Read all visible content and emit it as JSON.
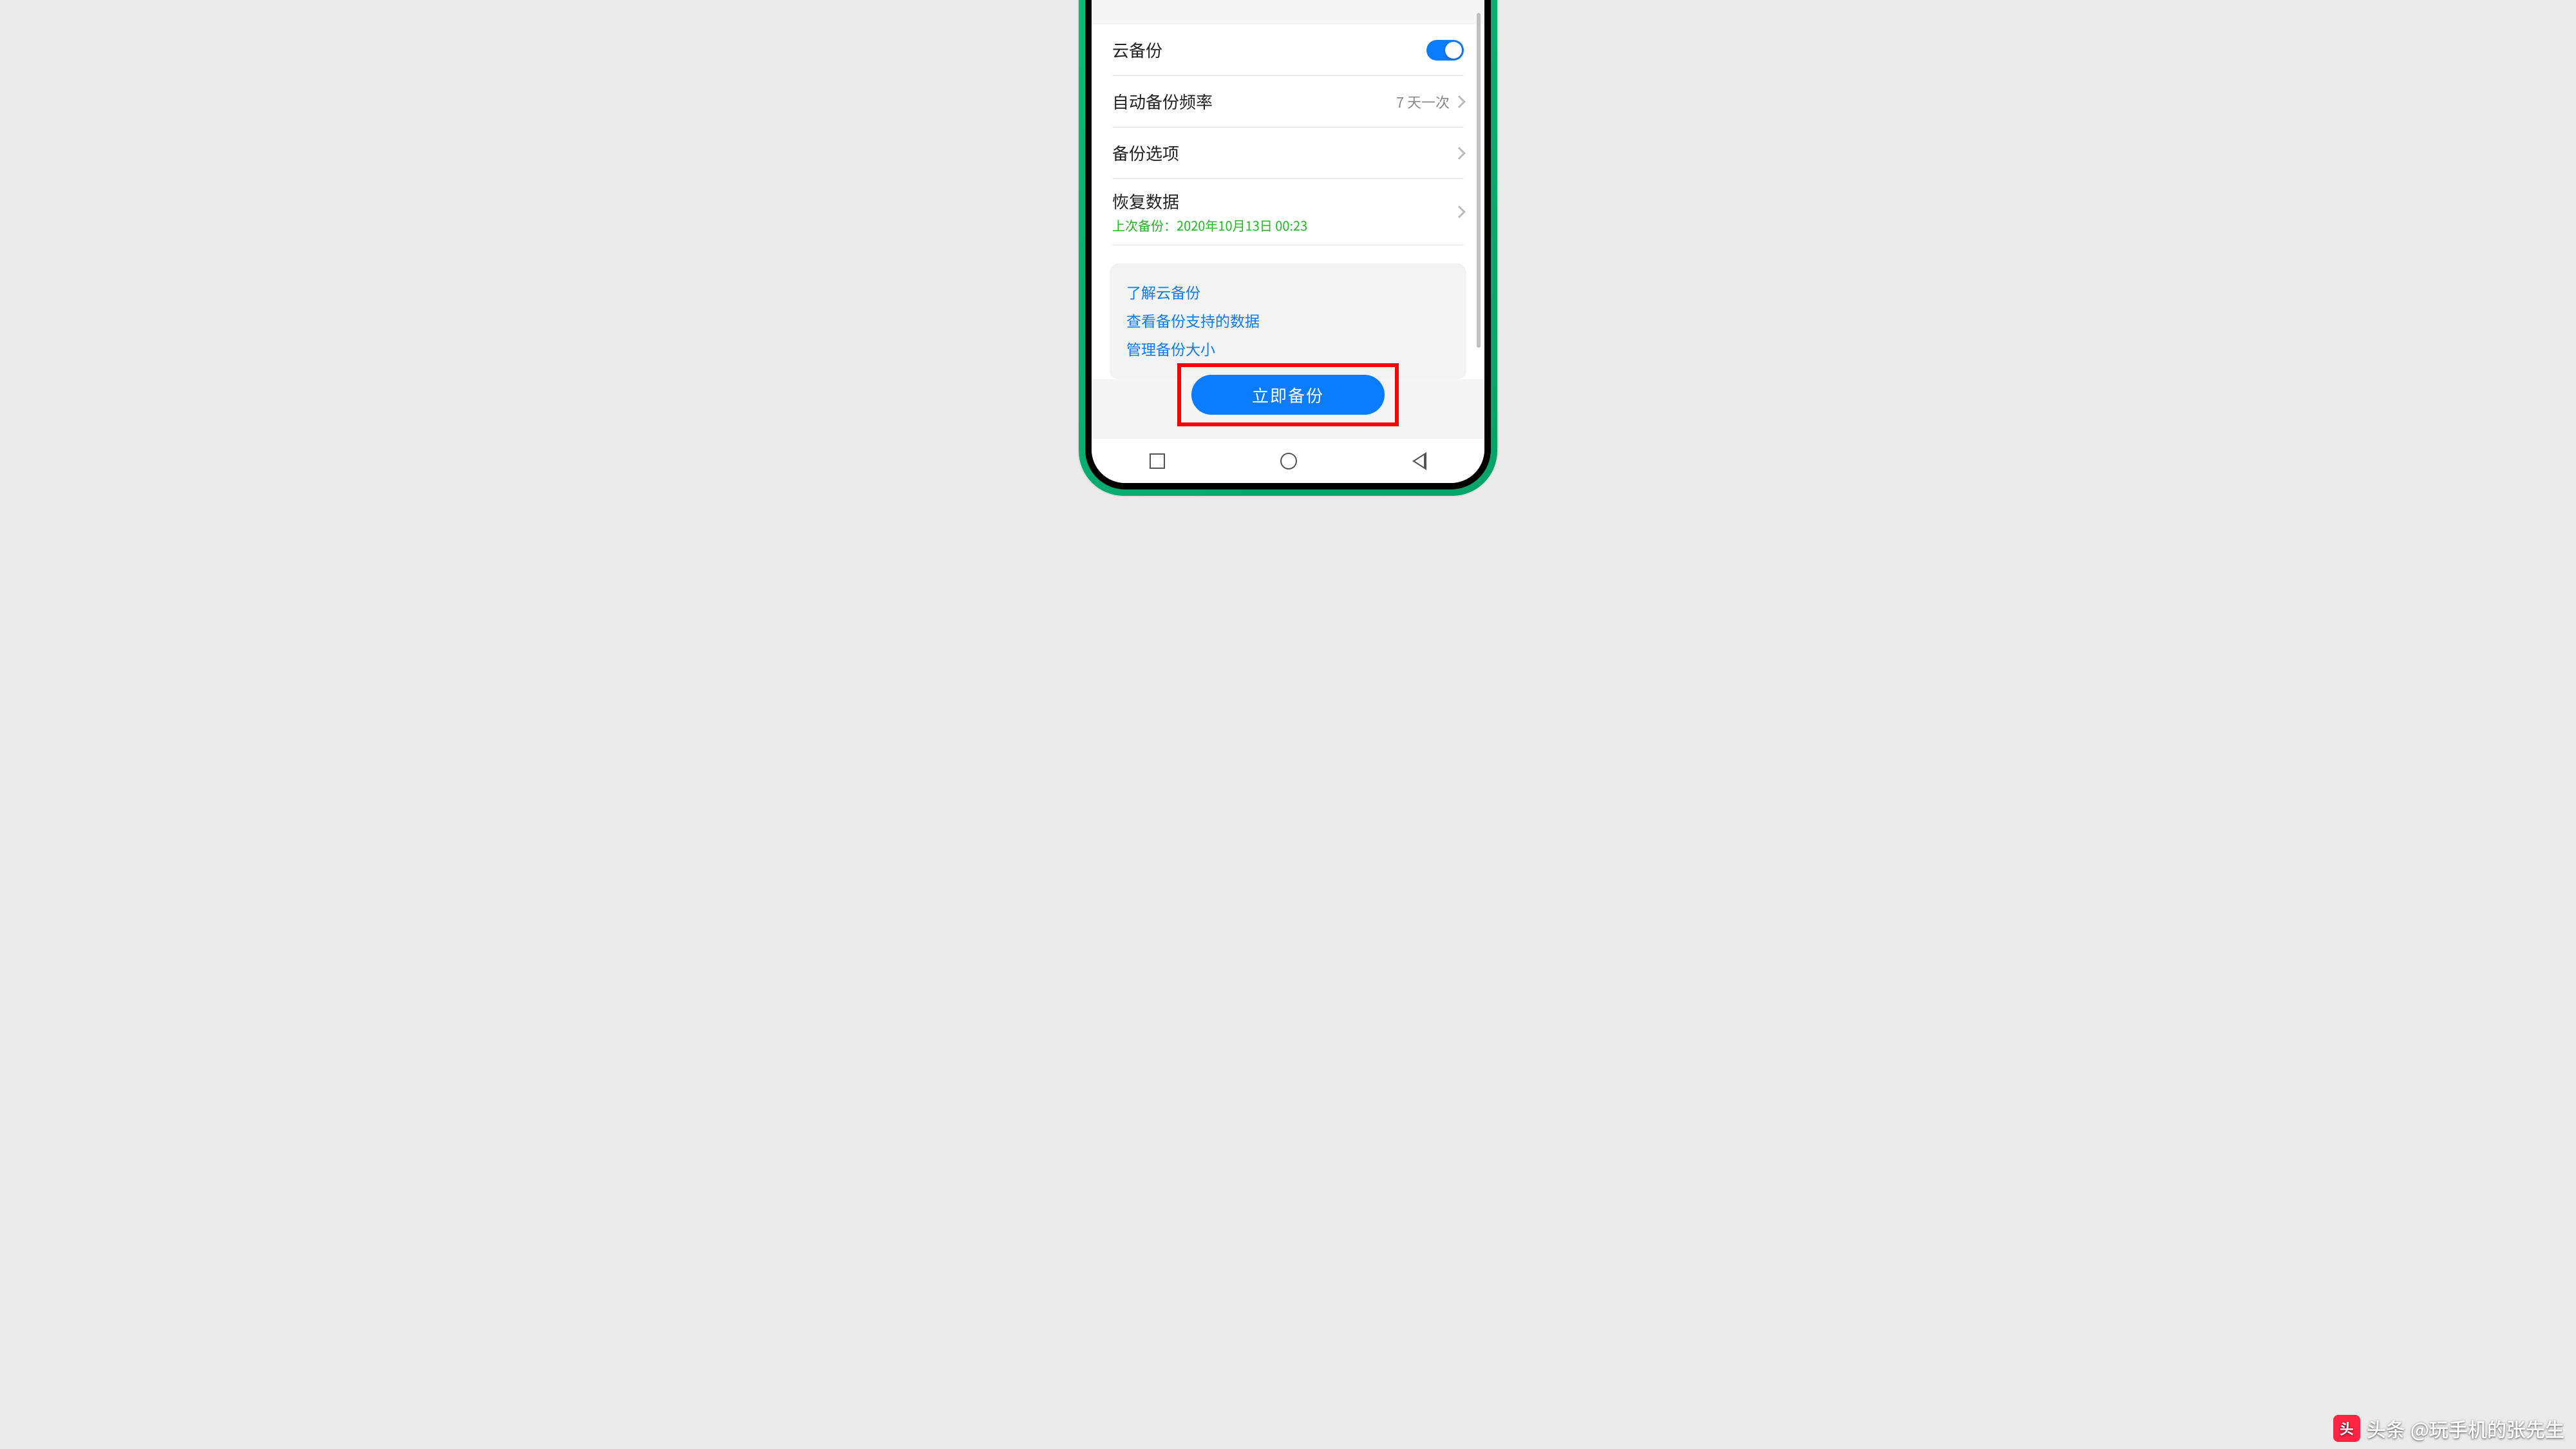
{
  "settings": {
    "cloud_backup": {
      "label": "云备份",
      "enabled": true
    },
    "auto_freq": {
      "label": "自动备份频率",
      "value": "7 天一次"
    },
    "options": {
      "label": "备份选项"
    },
    "restore": {
      "label": "恢复数据",
      "last": "上次备份：2020年10月13日 00:23"
    }
  },
  "info_links": {
    "learn": "了解云备份",
    "support": "查看备份支持的数据",
    "manage": "管理备份大小"
  },
  "button": {
    "backup_now": "立即备份"
  },
  "watermark": {
    "brand": "头条",
    "author": "@玩手机的张先生"
  }
}
